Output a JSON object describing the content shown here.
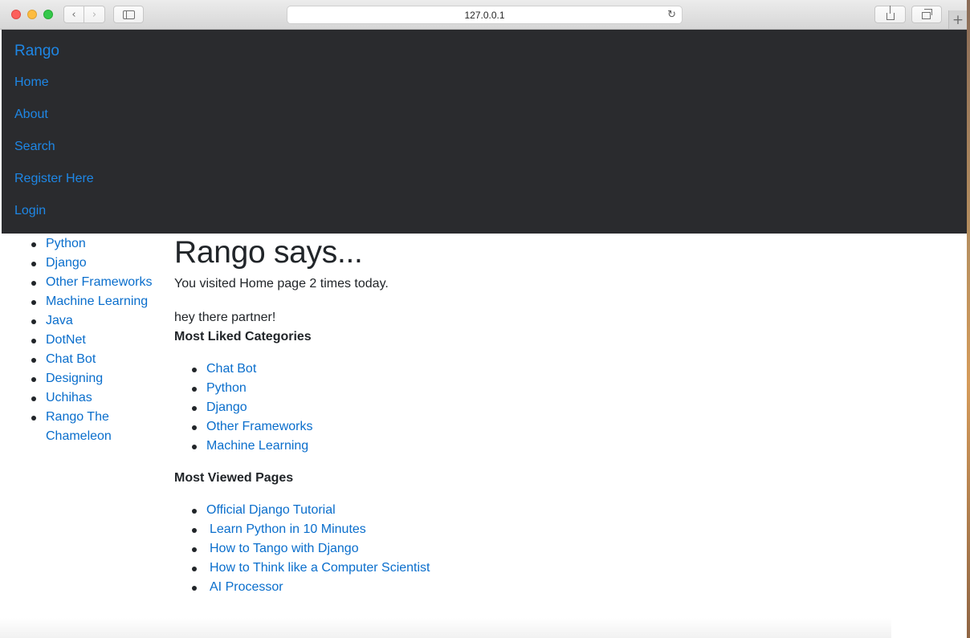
{
  "browser": {
    "url": "127.0.0.1",
    "back_icon": "chevron-left",
    "forward_icon": "chevron-right",
    "reload_icon": "reload",
    "new_tab_label": "+"
  },
  "navbar": {
    "brand": "Rango",
    "links": [
      "Home",
      "About",
      "Search",
      "Register Here",
      "Login"
    ]
  },
  "sidebar": {
    "categories": [
      "Python",
      "Django",
      "Other Frameworks",
      "Machine Learning",
      "Java",
      "DotNet",
      "Chat Bot",
      "Designing",
      "Uchihas",
      "Rango The Chameleon"
    ]
  },
  "main": {
    "heading": "Rango says...",
    "visits": "You visited Home page 2 times today.",
    "greeting": "hey there partner!",
    "liked_title": "Most Liked Categories",
    "liked": [
      "Chat Bot",
      "Python",
      "Django",
      "Other Frameworks",
      "Machine Learning"
    ],
    "viewed_title": "Most Viewed Pages",
    "viewed": [
      "Official Django Tutorial",
      "Learn Python in 10 Minutes",
      "How to Tango with Django",
      "How to Think like a Computer Scientist",
      "AI Processor"
    ]
  },
  "colors": {
    "link": "#1e87e6",
    "navbar_bg": "#2a2b2e",
    "text": "#212529"
  }
}
